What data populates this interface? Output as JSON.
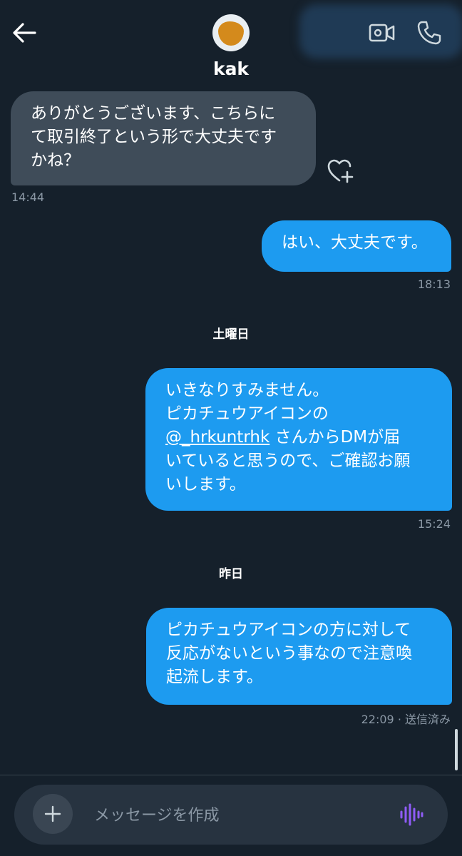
{
  "header": {
    "contact_name": "kak",
    "back_icon": "back-arrow-icon",
    "video_icon": "video-camera-icon",
    "phone_icon": "phone-icon"
  },
  "messages": [
    {
      "direction": "in",
      "text": "ありがとうございます、こちらに\nて取引終了という形で大丈夫です\nかね？",
      "time": "14:44"
    },
    {
      "direction": "out",
      "text": "はい、大丈夫です。",
      "time": "18:13"
    },
    {
      "direction": "out",
      "text_before": "いきなりすみません。\nピカチュウアイコンの\n",
      "mention": "@_hrkuntrhk",
      "text_after": " さんからDMが届\nいていると思うので、ご確認お願\nいします。",
      "time": "15:24"
    },
    {
      "direction": "out",
      "text": "ピカチュウアイコンの方に対して\n反応がないという事なので注意喚\n起流します。",
      "time": "22:09 · 送信済み"
    }
  ],
  "day_separators": [
    "土曜日",
    "昨日"
  ],
  "composer": {
    "placeholder": "メッセージを作成",
    "add_icon": "plus-icon",
    "voice_icon": "voice-waveform-icon"
  },
  "colors": {
    "background": "#15202b",
    "outgoing_bubble": "#1d9bf0",
    "incoming_bubble": "#3f4c59",
    "timestamp": "#8b98a5",
    "voice_accent": "#8f5cf7"
  }
}
